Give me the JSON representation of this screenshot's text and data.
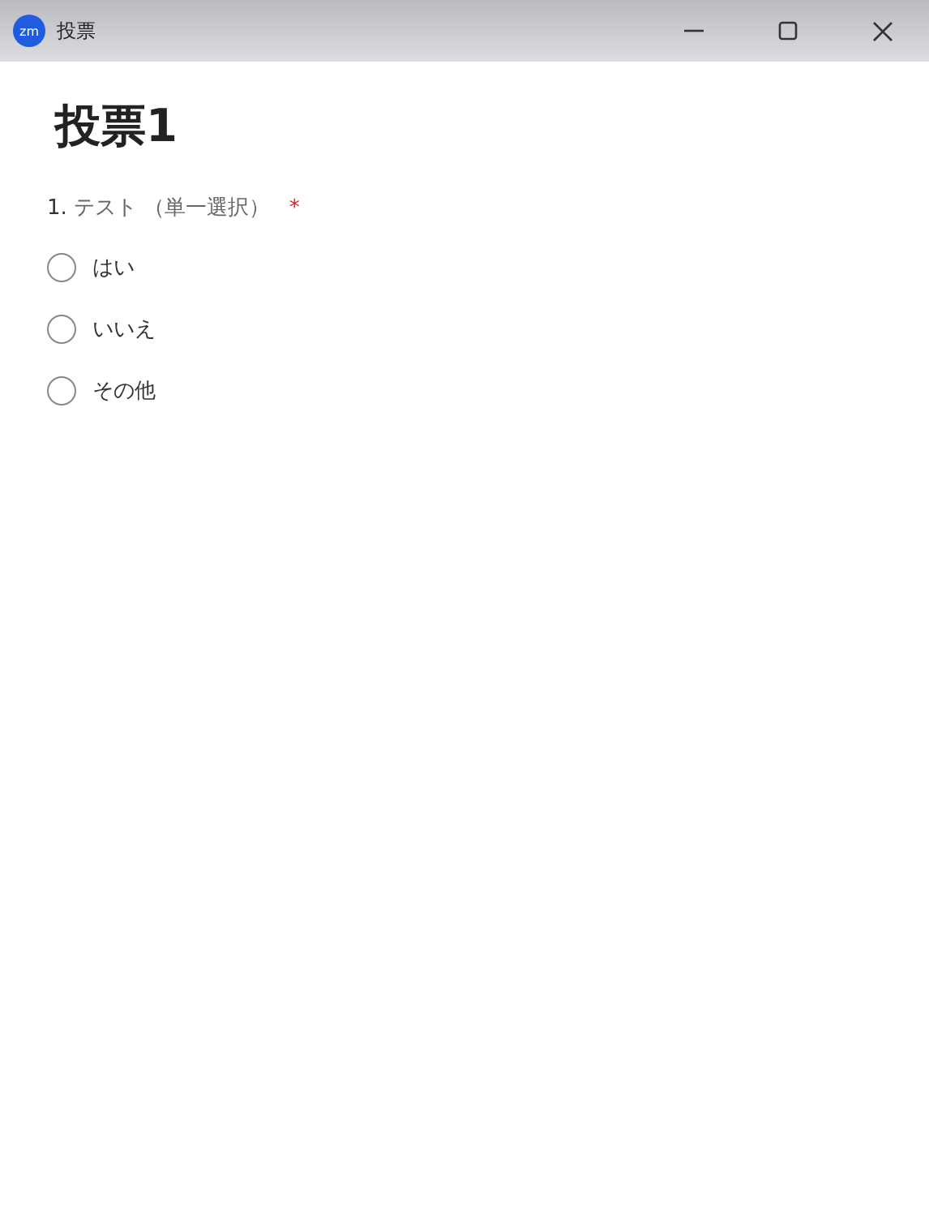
{
  "window": {
    "logo": "zm",
    "title": "投票"
  },
  "poll": {
    "title": "投票1",
    "question": {
      "number": "1.",
      "text": "テスト",
      "type": "（単一選択）",
      "required_mark": "*",
      "options": [
        {
          "label": "はい",
          "selected": false
        },
        {
          "label": "いいえ",
          "selected": false
        },
        {
          "label": "その他",
          "selected": false
        }
      ]
    }
  }
}
